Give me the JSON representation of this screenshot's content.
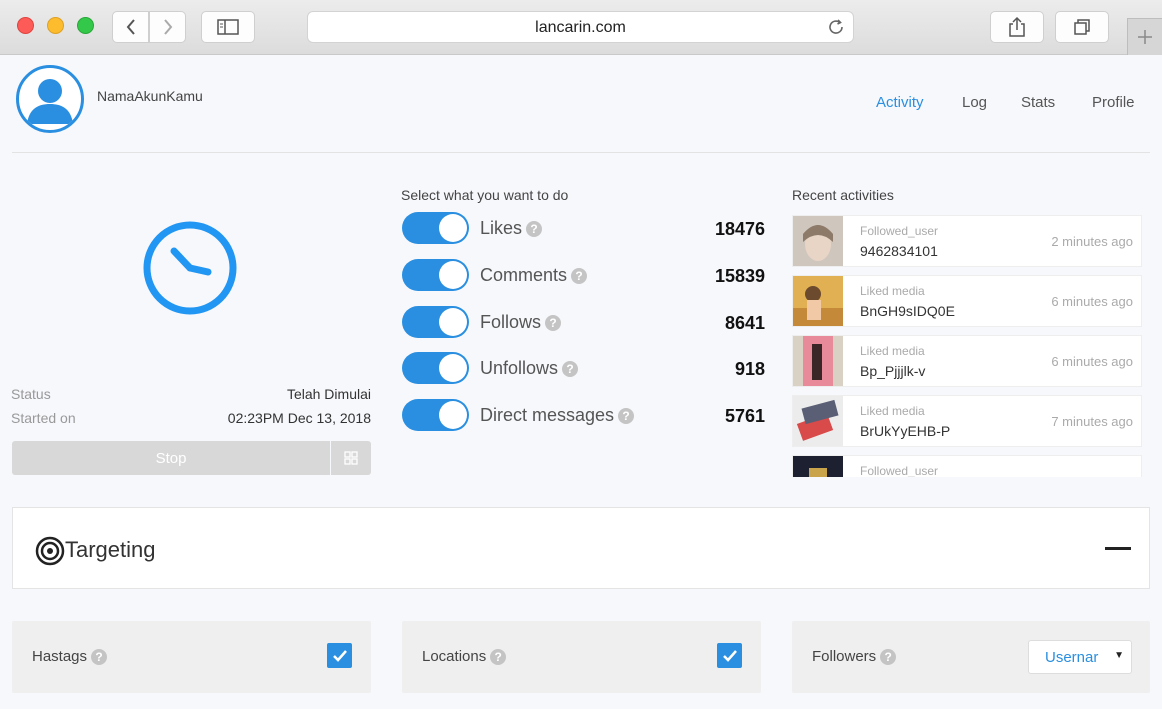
{
  "browser": {
    "url": "lancarin.com"
  },
  "header": {
    "username": "NamaAkunKamu",
    "nav": [
      "Activity",
      "Log",
      "Stats",
      "Profile"
    ],
    "active_nav": "Activity"
  },
  "status": {
    "status_label": "Status",
    "status_value": "Telah Dimulai",
    "started_label": "Started on",
    "started_value": "02:23PM Dec 13, 2018",
    "stop_label": "Stop"
  },
  "actions": {
    "title": "Select what you want to do",
    "items": [
      {
        "label": "Likes",
        "count": "18476",
        "enabled": true
      },
      {
        "label": "Comments",
        "count": "15839",
        "enabled": true
      },
      {
        "label": "Follows",
        "count": "8641",
        "enabled": true
      },
      {
        "label": "Unfollows",
        "count": "918",
        "enabled": true
      },
      {
        "label": "Direct messages",
        "count": "5761",
        "enabled": true
      }
    ]
  },
  "recent": {
    "title": "Recent activities",
    "items": [
      {
        "type": "Followed_user",
        "id": "9462834101",
        "time": "2 minutes ago"
      },
      {
        "type": "Liked media",
        "id": "BnGH9sIDQ0E",
        "time": "6 minutes ago"
      },
      {
        "type": "Liked media",
        "id": "Bp_Pjjjlk-v",
        "time": "6 minutes ago"
      },
      {
        "type": "Liked media",
        "id": "BrUkYyEHB-P",
        "time": "7 minutes ago"
      },
      {
        "type": "Followed_user",
        "id": "",
        "time": ""
      }
    ]
  },
  "targeting": {
    "title": "Targeting",
    "cards": [
      {
        "label": "Hastags",
        "checked": true
      },
      {
        "label": "Locations",
        "checked": true
      },
      {
        "label": "Followers",
        "select_value": "Usernar"
      }
    ]
  },
  "colors": {
    "accent": "#2a8fe0"
  }
}
